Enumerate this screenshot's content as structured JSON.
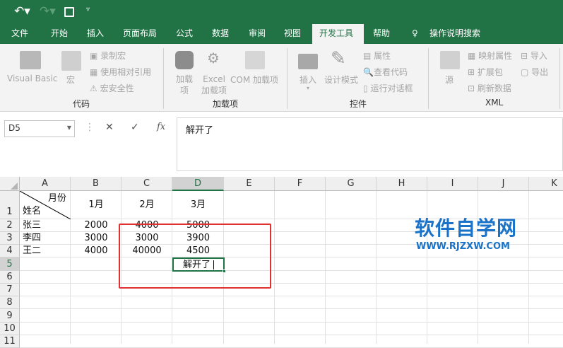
{
  "quick_access": {
    "undo": "undo-icon",
    "redo": "redo-icon",
    "save": "save-icon",
    "customize": "customize-icon"
  },
  "tabs": [
    "文件",
    "开始",
    "插入",
    "页面布局",
    "公式",
    "数据",
    "审阅",
    "视图",
    "开发工具",
    "帮助"
  ],
  "active_tab": "开发工具",
  "tell_me": "操作说明搜索",
  "ribbon": {
    "code": {
      "label": "代码",
      "visual_basic": "Visual Basic",
      "macros": "宏",
      "record": "录制宏",
      "relative": "使用相对引用",
      "security": "宏安全性"
    },
    "addins": {
      "label": "加载项",
      "addins": "加载项",
      "excel_addins_1": "Excel",
      "excel_addins_2": "加载项",
      "com": "COM 加载项"
    },
    "controls": {
      "label": "控件",
      "insert": "插入",
      "design": "设计模式",
      "properties": "属性",
      "view_code": "查看代码",
      "run_dialog": "运行对话框"
    },
    "xml": {
      "label": "XML",
      "source": "源",
      "map_props": "映射属性",
      "expansion": "扩展包",
      "refresh": "刷新数据",
      "import": "导入",
      "export": "导出"
    }
  },
  "name_box": "D5",
  "formula_value": "解开了",
  "columns": [
    "A",
    "B",
    "C",
    "D",
    "E",
    "F",
    "G",
    "H",
    "I",
    "J",
    "K"
  ],
  "selected_column": "D",
  "rows": [
    "1",
    "2",
    "3",
    "4",
    "5",
    "6",
    "7",
    "8",
    "9",
    "10",
    "11"
  ],
  "header": {
    "diag_top": "月份",
    "diag_bottom": "姓名",
    "b": "1月",
    "c": "2月",
    "d": "3月"
  },
  "data": [
    [
      "张三",
      "2000",
      "4000",
      "5000"
    ],
    [
      "李四",
      "3000",
      "3000",
      "3900"
    ],
    [
      "王二",
      "4000",
      "40000",
      "4500"
    ]
  ],
  "active_cell": "解开了",
  "watermark": {
    "title": "软件自学网",
    "url": "WWW.RJZXW.COM",
    "color": "#1a73c8"
  },
  "colors": {
    "brand": "#217346",
    "highlight": "#e03030"
  }
}
